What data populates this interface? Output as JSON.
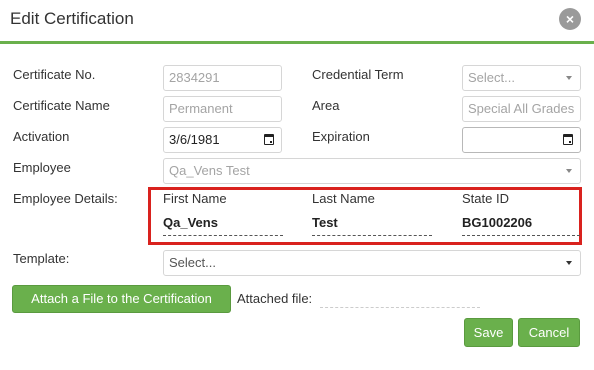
{
  "dialog": {
    "title": "Edit Certification",
    "close_glyph": "×"
  },
  "form": {
    "certificate_no_label": "Certificate No.",
    "certificate_no_value": "2834291",
    "credential_term_label": "Credential Term",
    "credential_term_placeholder": "Select...",
    "certificate_name_label": "Certificate Name",
    "certificate_name_value": "Permanent",
    "area_label": "Area",
    "area_value": "Special All Grades",
    "activation_label": "Activation",
    "activation_value": "3/6/1981",
    "expiration_label": "Expiration",
    "expiration_value": "",
    "employee_label": "Employee",
    "employee_value": "Qa_Vens Test",
    "employee_details_label": "Employee Details:",
    "template_label": "Template:",
    "template_placeholder": "Select..."
  },
  "employee_details": {
    "first_name_header": "First Name",
    "first_name_value": "Qa_Vens",
    "last_name_header": "Last Name",
    "last_name_value": "Test",
    "state_id_header": "State ID",
    "state_id_value": "BG1002206"
  },
  "attachment": {
    "attach_button_label": "Attach a File to the Certification",
    "attached_file_label": "Attached file:"
  },
  "actions": {
    "save_label": "Save",
    "cancel_label": "Cancel"
  },
  "colors": {
    "accent_green": "#6ab04c",
    "highlight_red": "#d9221e",
    "close_gray": "#9a9a9a"
  }
}
